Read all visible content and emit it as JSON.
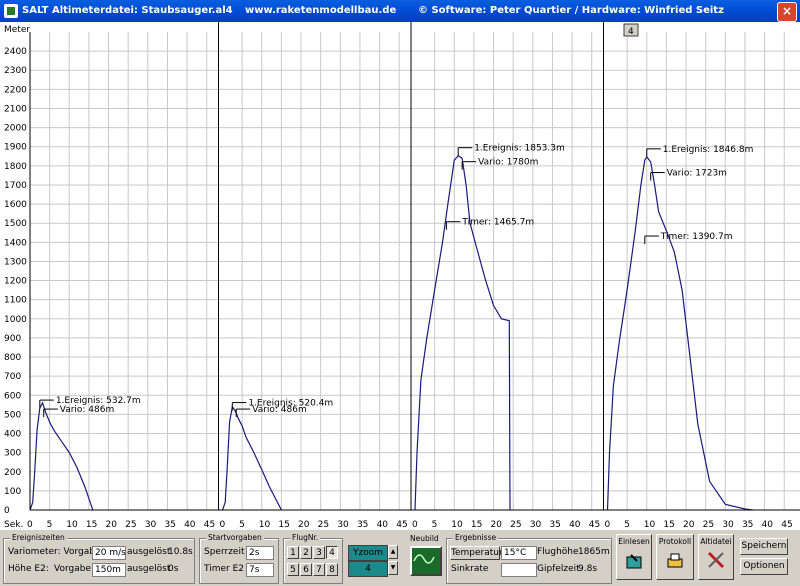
{
  "window": {
    "title_left": "SALT Altimeterdatei: Staubsauger.al4",
    "title_center": "www.raketenmodellbau.de",
    "title_right": "© Software: Peter Quartier / Hardware: Winfried Seitz",
    "close": "×"
  },
  "chart_data": {
    "type": "line",
    "ylabel": "Meter",
    "xlabel": "Sek.",
    "ylim": [
      0,
      2500
    ],
    "yticks": [
      0,
      100,
      200,
      300,
      400,
      500,
      600,
      700,
      800,
      900,
      1000,
      1100,
      1200,
      1300,
      1400,
      1500,
      1600,
      1700,
      1800,
      1900,
      2000,
      2100,
      2200,
      2300,
      2400
    ],
    "xlim_per_panel": [
      0,
      48
    ],
    "xtick_labels": [
      "0",
      "5",
      "10",
      "15",
      "20",
      "25",
      "30",
      "35",
      "40",
      "45"
    ],
    "grid": true,
    "page_indicator": "4",
    "flights": [
      {
        "points": [
          [
            0,
            0
          ],
          [
            0.7,
            40
          ],
          [
            1.2,
            200
          ],
          [
            1.8,
            420
          ],
          [
            2.5,
            533
          ],
          [
            3.2,
            560
          ],
          [
            4,
            510
          ],
          [
            5,
            460
          ],
          [
            6,
            420
          ],
          [
            8,
            360
          ],
          [
            10,
            300
          ],
          [
            12,
            220
          ],
          [
            14,
            120
          ],
          [
            16,
            0
          ]
        ],
        "annotations": [
          {
            "label": "1.Ereignis: 532.7m",
            "x": 2.5,
            "y": 533
          },
          {
            "label": "Vario: 486m",
            "x": 3.5,
            "y": 486
          }
        ]
      },
      {
        "points": [
          [
            0,
            0
          ],
          [
            0.7,
            40
          ],
          [
            1.2,
            220
          ],
          [
            1.8,
            460
          ],
          [
            2.5,
            540
          ],
          [
            3.2,
            520
          ],
          [
            4,
            480
          ],
          [
            5,
            440
          ],
          [
            6,
            380
          ],
          [
            8,
            300
          ],
          [
            10,
            210
          ],
          [
            12,
            120
          ],
          [
            14,
            40
          ],
          [
            15,
            0
          ]
        ],
        "annotations": [
          {
            "label": "1.Ereignis: 520.4m",
            "x": 2.5,
            "y": 520
          },
          {
            "label": "Vario: 486m",
            "x": 3.5,
            "y": 486
          }
        ]
      },
      {
        "points": [
          [
            0,
            0
          ],
          [
            0.5,
            300
          ],
          [
            1.5,
            680
          ],
          [
            3,
            900
          ],
          [
            5,
            1150
          ],
          [
            7,
            1400
          ],
          [
            8.5,
            1620
          ],
          [
            10,
            1830
          ],
          [
            11,
            1853
          ],
          [
            12,
            1840
          ],
          [
            13,
            1700
          ],
          [
            14,
            1500
          ],
          [
            16,
            1350
          ],
          [
            18,
            1200
          ],
          [
            20,
            1070
          ],
          [
            22,
            1000
          ],
          [
            24,
            990
          ],
          [
            24.2,
            0
          ]
        ],
        "annotations": [
          {
            "label": "1.Ereignis: 1853.3m",
            "x": 11,
            "y": 1853
          },
          {
            "label": "Vario: 1780m",
            "x": 12,
            "y": 1780
          },
          {
            "label": "Timer: 1465.7m",
            "x": 8,
            "y": 1466
          }
        ]
      },
      {
        "points": [
          [
            0,
            0
          ],
          [
            0.5,
            300
          ],
          [
            1.5,
            650
          ],
          [
            3,
            880
          ],
          [
            5,
            1150
          ],
          [
            7,
            1450
          ],
          [
            8.5,
            1700
          ],
          [
            9.5,
            1830
          ],
          [
            10,
            1847
          ],
          [
            11,
            1820
          ],
          [
            12,
            1700
          ],
          [
            13,
            1560
          ],
          [
            15,
            1460
          ],
          [
            17,
            1350
          ],
          [
            19,
            1150
          ],
          [
            21,
            800
          ],
          [
            23,
            450
          ],
          [
            26,
            150
          ],
          [
            30,
            30
          ],
          [
            35,
            5
          ],
          [
            37,
            0
          ]
        ],
        "annotations": [
          {
            "label": "1.Ereignis: 1846.8m",
            "x": 10,
            "y": 1847
          },
          {
            "label": "Vario: 1723m",
            "x": 11,
            "y": 1723
          },
          {
            "label": "Timer: 1390.7m",
            "x": 9.5,
            "y": 1391
          }
        ]
      }
    ]
  },
  "ereigniszeiten": {
    "title": "Ereigniszeiten",
    "row1_label": "Variometer: Vorgabe",
    "row1_value": "20 m/s",
    "row1_ausgeloest_label": "ausgelöst",
    "row1_ausgeloest_value": "10.8s",
    "row2_label": "Höhe E2:",
    "row2_vorgabe_label": "Vorgabe",
    "row2_value": "150m",
    "row2_ausgeloest_label": "ausgelöst",
    "row2_ausgeloest_value": "0s"
  },
  "startvorgaben": {
    "title": "Startvorgaben",
    "sperrzeit_label": "Sperrzeit",
    "sperrzeit_value": "2s",
    "timer_label": "Timer E2",
    "timer_value": "7s"
  },
  "flugnr": {
    "title": "FlugNr.",
    "buttons": [
      "1",
      "2",
      "3",
      "4",
      "5",
      "6",
      "7",
      "8"
    ]
  },
  "yzoom": {
    "label": "Yzoom",
    "value": "4",
    "up": "▲",
    "down": "▼"
  },
  "neubild": {
    "title": "Neubild"
  },
  "ergebnisse": {
    "title": "Ergebnisse",
    "temperatur_label": "Temperatur",
    "temperatur_value": "15°C",
    "sinkrate_label": "Sinkrate",
    "sinkrate_value": "",
    "flughoehe_label": "Flughöhe",
    "flughoehe_value": "1865m",
    "gipfelzeit_label": "Gipfelzeit",
    "gipfelzeit_value": "9.8s"
  },
  "actions": {
    "einlesen": "Einlesen",
    "protokoll": "Protokoll",
    "altidatei": "Altidatei",
    "speichern": "Speichern",
    "optionen": "Optionen"
  },
  "colors": {
    "curve": "#1a1a7a",
    "grid": "#c8c8c8",
    "separator": "#000000",
    "titlebar": "#0048d0"
  }
}
